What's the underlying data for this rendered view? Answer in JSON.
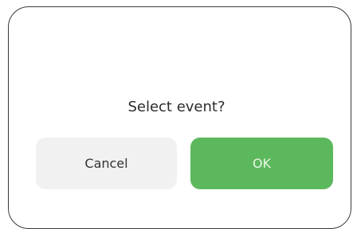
{
  "dialog": {
    "message": "Select event?",
    "cancel_label": "Cancel",
    "ok_label": "OK"
  },
  "colors": {
    "ok_button": "#5cb85c",
    "cancel_button": "#f1f1f1"
  }
}
